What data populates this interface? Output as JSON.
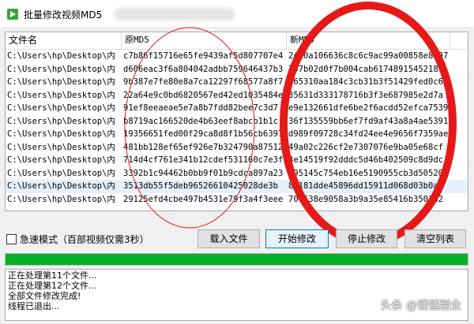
{
  "window": {
    "title": "批量修改视频MD5"
  },
  "table": {
    "columns": [
      "文件名",
      "原MD5",
      "新MD5",
      ""
    ],
    "rows": [
      [
        "C:\\Users\\hp\\Desktop\\内",
        "c7b86f15716e65fe9439af5d807707e4",
        "2420a106636c8c6c9ac99a00858e8b97",
        ""
      ],
      [
        "C:\\Users\\hp\\Desktop\\内",
        "d606eac3f6a804042adbb759646437b3",
        "757b02d0f7b004cab61748915452187",
        ""
      ],
      [
        "C:\\Users\\hp\\Desktop\\内",
        "9b387e7fe80e8a7ca12297f68577a8f7",
        "e65310aa184c3cb31b3f51429fed0c60",
        ""
      ],
      [
        "C:\\Users\\hp\\Desktop\\内",
        "22a64e9c0bd6820567ed42ed1035484e",
        "35631d333178716b3f3e687985e2d7a",
        ""
      ],
      [
        "C:\\Users\\hp\\Desktop\\内",
        "91ef8eeaeae5e7a8b7fdd82bee7c3d7",
        "e9e132661dfe6be2f6acdd52efca7539",
        ""
      ],
      [
        "C:\\Users\\hp\\Desktop\\内",
        "b8719ac166520de4b63eef8abcb1b1c",
        "36f135559bb6ef7fd9af43a8a4ae5391",
        ""
      ],
      [
        "C:\\Users\\hp\\Desktop\\内",
        "19356651fed00f29ca8d8f1b56cb6397",
        "d989f09728c34fd24ee4e9656f7359ae",
        ""
      ],
      [
        "C:\\Users\\hp\\Desktop\\内",
        "481bb128ef65ef926e7b324790a87512",
        "49a02c226cf2e7307076e9ba05e68cf",
        ""
      ],
      [
        "C:\\Users\\hp\\Desktop\\内",
        "714d4cf761e341b12cdef531160c7e3f",
        "3e14519f92dddc5d46b402509c8d9dc",
        ""
      ],
      [
        "C:\\Users\\hp\\Desktop\\内",
        "3392b1c94462b0bb9f01b9cdca897a23",
        "a95145c754eb16e5190955cb3d50520a",
        ""
      ],
      [
        "C:\\Users\\hp\\Desktop\\内",
        "3513db55f5deb96526610425028de3b",
        "85181dde45896dd15911d068d03b0ab",
        ""
      ],
      [
        "C:\\Users\\hp\\Desktop\\内",
        "29125efd4cbe497b4531e79f3a4f3eee",
        "704538e9058a3b9a35e85416b350182",
        ""
      ]
    ],
    "selected_row": 10
  },
  "options": {
    "fast_mode_label": "急速模式（百部视频仅需3秒）"
  },
  "buttons": {
    "load": "载入文件",
    "start": "开始修改",
    "stop": "停止修改",
    "clear": "清空列表"
  },
  "progress": {
    "value": 100
  },
  "log": [
    "正在处理第11个文件...",
    "正在处理第12个文件...",
    "全部文件修改完成!",
    "线程已退出..."
  ],
  "watermark": "头条 @懂懂副业",
  "colors": {
    "progress": "#06b025",
    "annotation": "#e61919",
    "selection": "#e5f0fb"
  }
}
